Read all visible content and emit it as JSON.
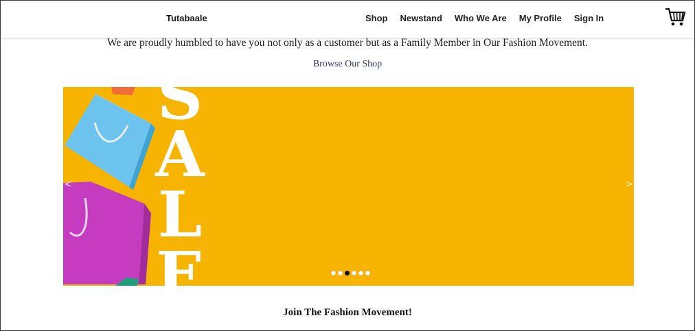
{
  "header": {
    "brand": "Tutabaale",
    "nav": [
      {
        "label": "Shop"
      },
      {
        "label": "Newstand"
      },
      {
        "label": "Who We Are"
      },
      {
        "label": "My Profile"
      },
      {
        "label": "Sign In"
      }
    ],
    "cart_icon": "shopping-cart-icon"
  },
  "main": {
    "welcome_text": "We are proudly humbled to have you not only as a customer but as a Family Member in Our Fashion Movement.",
    "browse_link": "Browse Our Shop",
    "carousel": {
      "banner_word": "SALE",
      "prev_arrow": "<",
      "next_arrow": ">",
      "slide_count": 6,
      "active_slide": 3,
      "background_color": "#f6b400"
    },
    "join_heading": "Join The Fashion Movement!"
  }
}
